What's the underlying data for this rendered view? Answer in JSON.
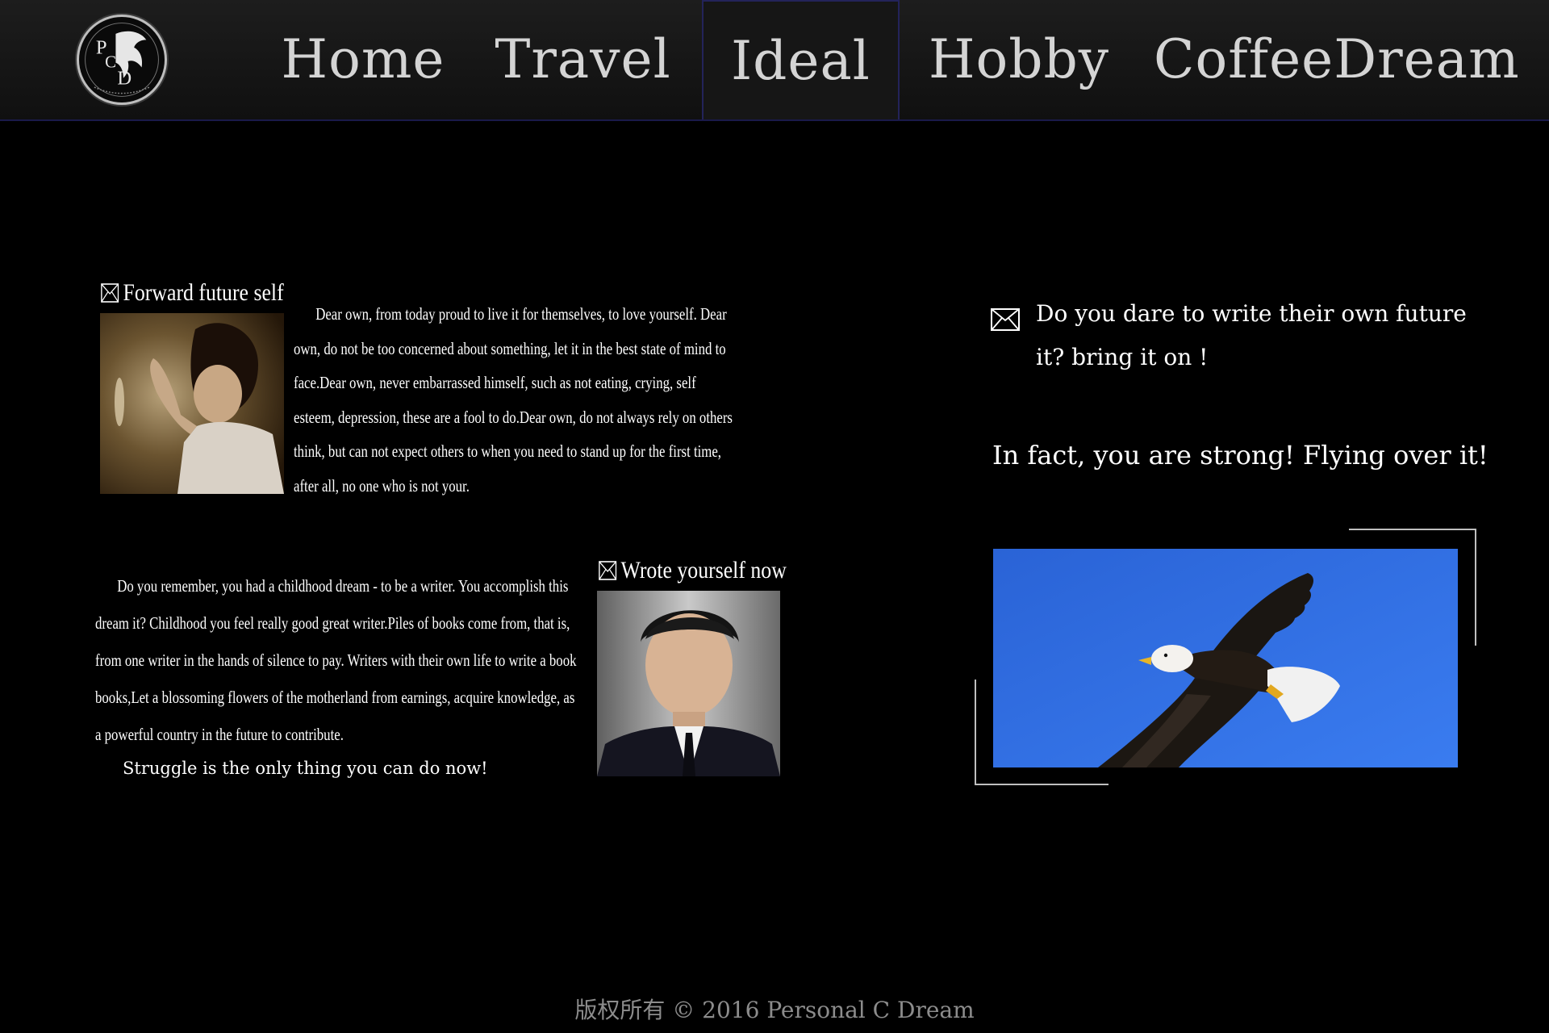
{
  "nav": {
    "logo_letters": "PCD",
    "items": [
      {
        "label": "Home"
      },
      {
        "label": "Travel"
      },
      {
        "label": "Ideal",
        "active": true
      },
      {
        "label": "Hobby"
      },
      {
        "label": "CoffeeDream"
      }
    ]
  },
  "section1": {
    "title": "Forward future self",
    "paragraph": "Dear own, from today proud to live it for themselves, to love yourself. Dear own, do not be too concerned about something, let it in the best state of mind to face.Dear own, never embarrassed himself, such as not eating, crying, self esteem, depression, these are a fool to do.Dear own, do not always rely on others think, but can not expect others to when you need to stand up for the first time, after all, no one who is not your."
  },
  "section2": {
    "title": "Wrote yourself now",
    "paragraph": "Do you remember, you had a childhood dream - to be a writer. You accomplish this dream it? Childhood you feel really good great writer.Piles of books come from, that is, from one writer in the hands of silence to pay. Writers with their own life to write a book books,Let a blossoming flowers of the motherland from earnings, acquire knowledge, as a powerful country in the future to contribute.",
    "closing": "Struggle is the only thing you can do now!"
  },
  "right": {
    "question": "Do you dare to write their own future it? bring it on !",
    "strong_line": "In fact, you are strong! Flying over it!"
  },
  "footer": {
    "copyright": "版权所有 © 2016 Personal C Dream"
  },
  "colors": {
    "background": "#000000",
    "nav_background": "#141414",
    "nav_text": "#d4d4d4",
    "active_border": "#23235a",
    "sky_blue": "#2e6fe0",
    "footer_text": "#8c8c8c"
  }
}
